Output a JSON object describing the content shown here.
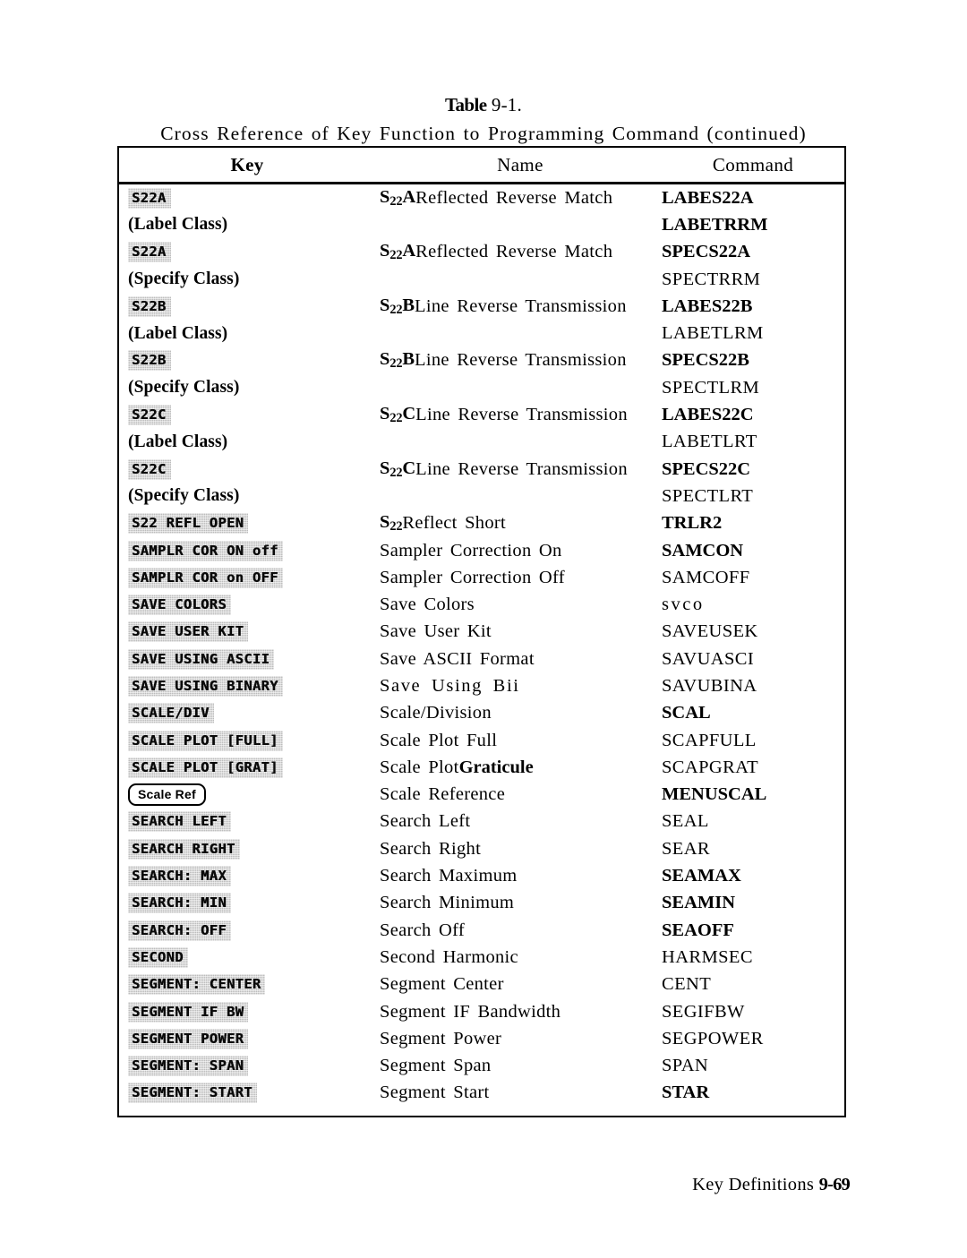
{
  "caption": {
    "table_word": "Table",
    "table_number": " 9-1.",
    "subtitle": "Cross Reference of Key Function to Programming Command (continued)"
  },
  "table": {
    "columns": [
      "Key",
      "Name",
      "Command"
    ],
    "rows": [
      {
        "key": "S22A",
        "key_type": "softkey",
        "name_prefix": "S",
        "name_sub": "22",
        "name_suffix": "A",
        "name_rest": " Reflected Reverse Match",
        "command": "LABES22A",
        "command_bold": true
      },
      {
        "key": "(Label Class)",
        "key_type": "text",
        "name_prefix": "",
        "name_sub": "",
        "name_suffix": "",
        "name_rest": "",
        "command": "LABETRRM",
        "command_bold": true
      },
      {
        "key": "S22A",
        "key_type": "softkey",
        "name_prefix": "S",
        "name_sub": "22",
        "name_suffix": "A",
        "name_rest": " Reflected Reverse Match",
        "command": "SPECS22A",
        "command_bold": true
      },
      {
        "key": "(Specify Class)",
        "key_type": "text",
        "name_prefix": "",
        "name_sub": "",
        "name_suffix": "",
        "name_rest": "",
        "command": "SPECTRRM",
        "command_bold": false
      },
      {
        "key": "S22B",
        "key_type": "softkey",
        "name_prefix": "S",
        "name_sub": "22",
        "name_suffix": "B",
        "name_rest": " Line Reverse Transmission",
        "command": "LABES22B",
        "command_bold": true
      },
      {
        "key": "(Label Class)",
        "key_type": "text",
        "name_prefix": "",
        "name_sub": "",
        "name_suffix": "",
        "name_rest": "",
        "command": "LABETLRM",
        "command_bold": false
      },
      {
        "key": "S22B",
        "key_type": "softkey",
        "name_prefix": "S",
        "name_sub": "22",
        "name_suffix": "B",
        "name_rest": " Line Reverse Transmission",
        "command": "SPECS22B",
        "command_bold": true
      },
      {
        "key": "(Specify Class)",
        "key_type": "text",
        "name_prefix": "",
        "name_sub": "",
        "name_suffix": "",
        "name_rest": "",
        "command": "SPECTLRM",
        "command_bold": false
      },
      {
        "key": "S22C",
        "key_type": "softkey",
        "name_prefix": "S",
        "name_sub": "22",
        "name_suffix": "C",
        "name_rest": " Line Reverse Transmission",
        "command": "LABES22C",
        "command_bold": true
      },
      {
        "key": "(Label Class)",
        "key_type": "text",
        "name_prefix": "",
        "name_sub": "",
        "name_suffix": "",
        "name_rest": "",
        "command": "LABETLRT",
        "command_bold": false
      },
      {
        "key": "S22C",
        "key_type": "softkey",
        "name_prefix": "S",
        "name_sub": "22",
        "name_suffix": "C",
        "name_rest": " Line Reverse Transmission",
        "command": "SPECS22C",
        "command_bold": true
      },
      {
        "key": "(Specify Class)",
        "key_type": "text",
        "name_prefix": "",
        "name_sub": "",
        "name_suffix": "",
        "name_rest": "",
        "command": "SPECTLRT",
        "command_bold": false
      },
      {
        "key": "S22 REFL OPEN",
        "key_type": "softkey",
        "name_prefix": "S",
        "name_sub": "22",
        "name_suffix": "",
        "name_rest": " Reflect Short",
        "command": "TRLR2",
        "command_bold": true
      },
      {
        "key": "SAMPLR COR ON off",
        "key_type": "softkey",
        "name_prefix": "",
        "name_sub": "",
        "name_suffix": "",
        "name_rest": "Sampler Correction On",
        "command": "SAMCON",
        "command_bold": true
      },
      {
        "key": "SAMPLR COR on OFF",
        "key_type": "softkey",
        "name_prefix": "",
        "name_sub": "",
        "name_suffix": "",
        "name_rest": "Sampler Correction Off",
        "command": "SAMCOFF",
        "command_bold": false
      },
      {
        "key": "SAVE COLORS",
        "key_type": "softkey",
        "name_prefix": "",
        "name_sub": "",
        "name_suffix": "",
        "name_rest": "Save Colors",
        "command": "svco",
        "command_bold": false,
        "command_spaced": true
      },
      {
        "key": "SAVE USER KIT",
        "key_type": "softkey",
        "name_prefix": "",
        "name_sub": "",
        "name_suffix": "",
        "name_rest": "Save User Kit",
        "command": "SAVEUSEK",
        "command_bold": false
      },
      {
        "key": "SAVE USING ASCII",
        "key_type": "softkey",
        "name_prefix": "",
        "name_sub": "",
        "name_suffix": "",
        "name_rest": "Save ASCII Format",
        "command": "SAVUASCI",
        "command_bold": false
      },
      {
        "key": "SAVE USING BINARY",
        "key_type": "softkey",
        "name_prefix": "",
        "name_sub": "",
        "name_suffix": "",
        "name_rest": "Save Using Bii",
        "command": "SAVUBINA",
        "command_bold": false,
        "name_wide": true
      },
      {
        "key": "SCALE/DIV",
        "key_type": "softkey",
        "name_prefix": "",
        "name_sub": "",
        "name_suffix": "",
        "name_rest": "Scale/Division",
        "command": "SCAL",
        "command_bold": true
      },
      {
        "key": "SCALE PLOT [FULL]",
        "key_type": "softkey",
        "name_prefix": "",
        "name_sub": "",
        "name_suffix": "",
        "name_rest": "Scale Plot Full",
        "command": "SCAPFULL",
        "command_bold": false
      },
      {
        "key": "SCALE PLOT [GRAT]",
        "key_type": "softkey",
        "name_prefix": "",
        "name_sub": "",
        "name_suffix": "",
        "name_rest": "Scale Plot ",
        "name_bold_tail": "Graticule",
        "command": "SCAPGRAT",
        "command_bold": false
      },
      {
        "key": "Scale Ref",
        "key_type": "hardkey",
        "name_prefix": "",
        "name_sub": "",
        "name_suffix": "",
        "name_rest": "Scale Reference",
        "command": "MENUSCAL",
        "command_bold": true
      },
      {
        "key": "SEARCH LEFT",
        "key_type": "softkey",
        "name_prefix": "",
        "name_sub": "",
        "name_suffix": "",
        "name_rest": "Search Left",
        "command": "SEAL",
        "command_bold": false
      },
      {
        "key": "SEARCH RIGHT",
        "key_type": "softkey",
        "name_prefix": "",
        "name_sub": "",
        "name_suffix": "",
        "name_rest": "Search Right",
        "command": "SEAR",
        "command_bold": false
      },
      {
        "key": "SEARCH: MAX",
        "key_type": "softkey",
        "name_prefix": "",
        "name_sub": "",
        "name_suffix": "",
        "name_rest": "Search Maximum",
        "command": "SEAMAX",
        "command_bold": true
      },
      {
        "key": "SEARCH: MIN",
        "key_type": "softkey",
        "name_prefix": "",
        "name_sub": "",
        "name_suffix": "",
        "name_rest": "Search Minimum",
        "command": "SEAMIN",
        "command_bold": true
      },
      {
        "key": "SEARCH: OFF",
        "key_type": "softkey",
        "name_prefix": "",
        "name_sub": "",
        "name_suffix": "",
        "name_rest": "Search Off",
        "command": "SEAOFF",
        "command_bold": true
      },
      {
        "key": "SECOND",
        "key_type": "softkey",
        "name_prefix": "",
        "name_sub": "",
        "name_suffix": "",
        "name_rest": "Second Harmonic",
        "command": "HARMSEC",
        "command_bold": false
      },
      {
        "key": "SEGMENT: CENTER",
        "key_type": "softkey",
        "name_prefix": "",
        "name_sub": "",
        "name_suffix": "",
        "name_rest": "Segment Center",
        "command": "CENT",
        "command_bold": false
      },
      {
        "key": "SEGMENT IF BW",
        "key_type": "softkey",
        "name_prefix": "",
        "name_sub": "",
        "name_suffix": "",
        "name_rest": "Segment IF Bandwidth",
        "command": "SEGIFBW",
        "command_bold": false
      },
      {
        "key": "SEGMENT POWER",
        "key_type": "softkey",
        "name_prefix": "",
        "name_sub": "",
        "name_suffix": "",
        "name_rest": "Segment Power",
        "command": "SEGPOWER",
        "command_bold": false
      },
      {
        "key": "SEGMENT: SPAN",
        "key_type": "softkey",
        "name_prefix": "",
        "name_sub": "",
        "name_suffix": "",
        "name_rest": "Segment Span",
        "command": "SPAN",
        "command_bold": false
      },
      {
        "key": "SEGMENT: START",
        "key_type": "softkey",
        "name_prefix": "",
        "name_sub": "",
        "name_suffix": "",
        "name_rest": "Segment Start",
        "command": "STAR",
        "command_bold": true
      }
    ]
  },
  "footer": {
    "label": "Key Definitions ",
    "page": "9-69"
  }
}
